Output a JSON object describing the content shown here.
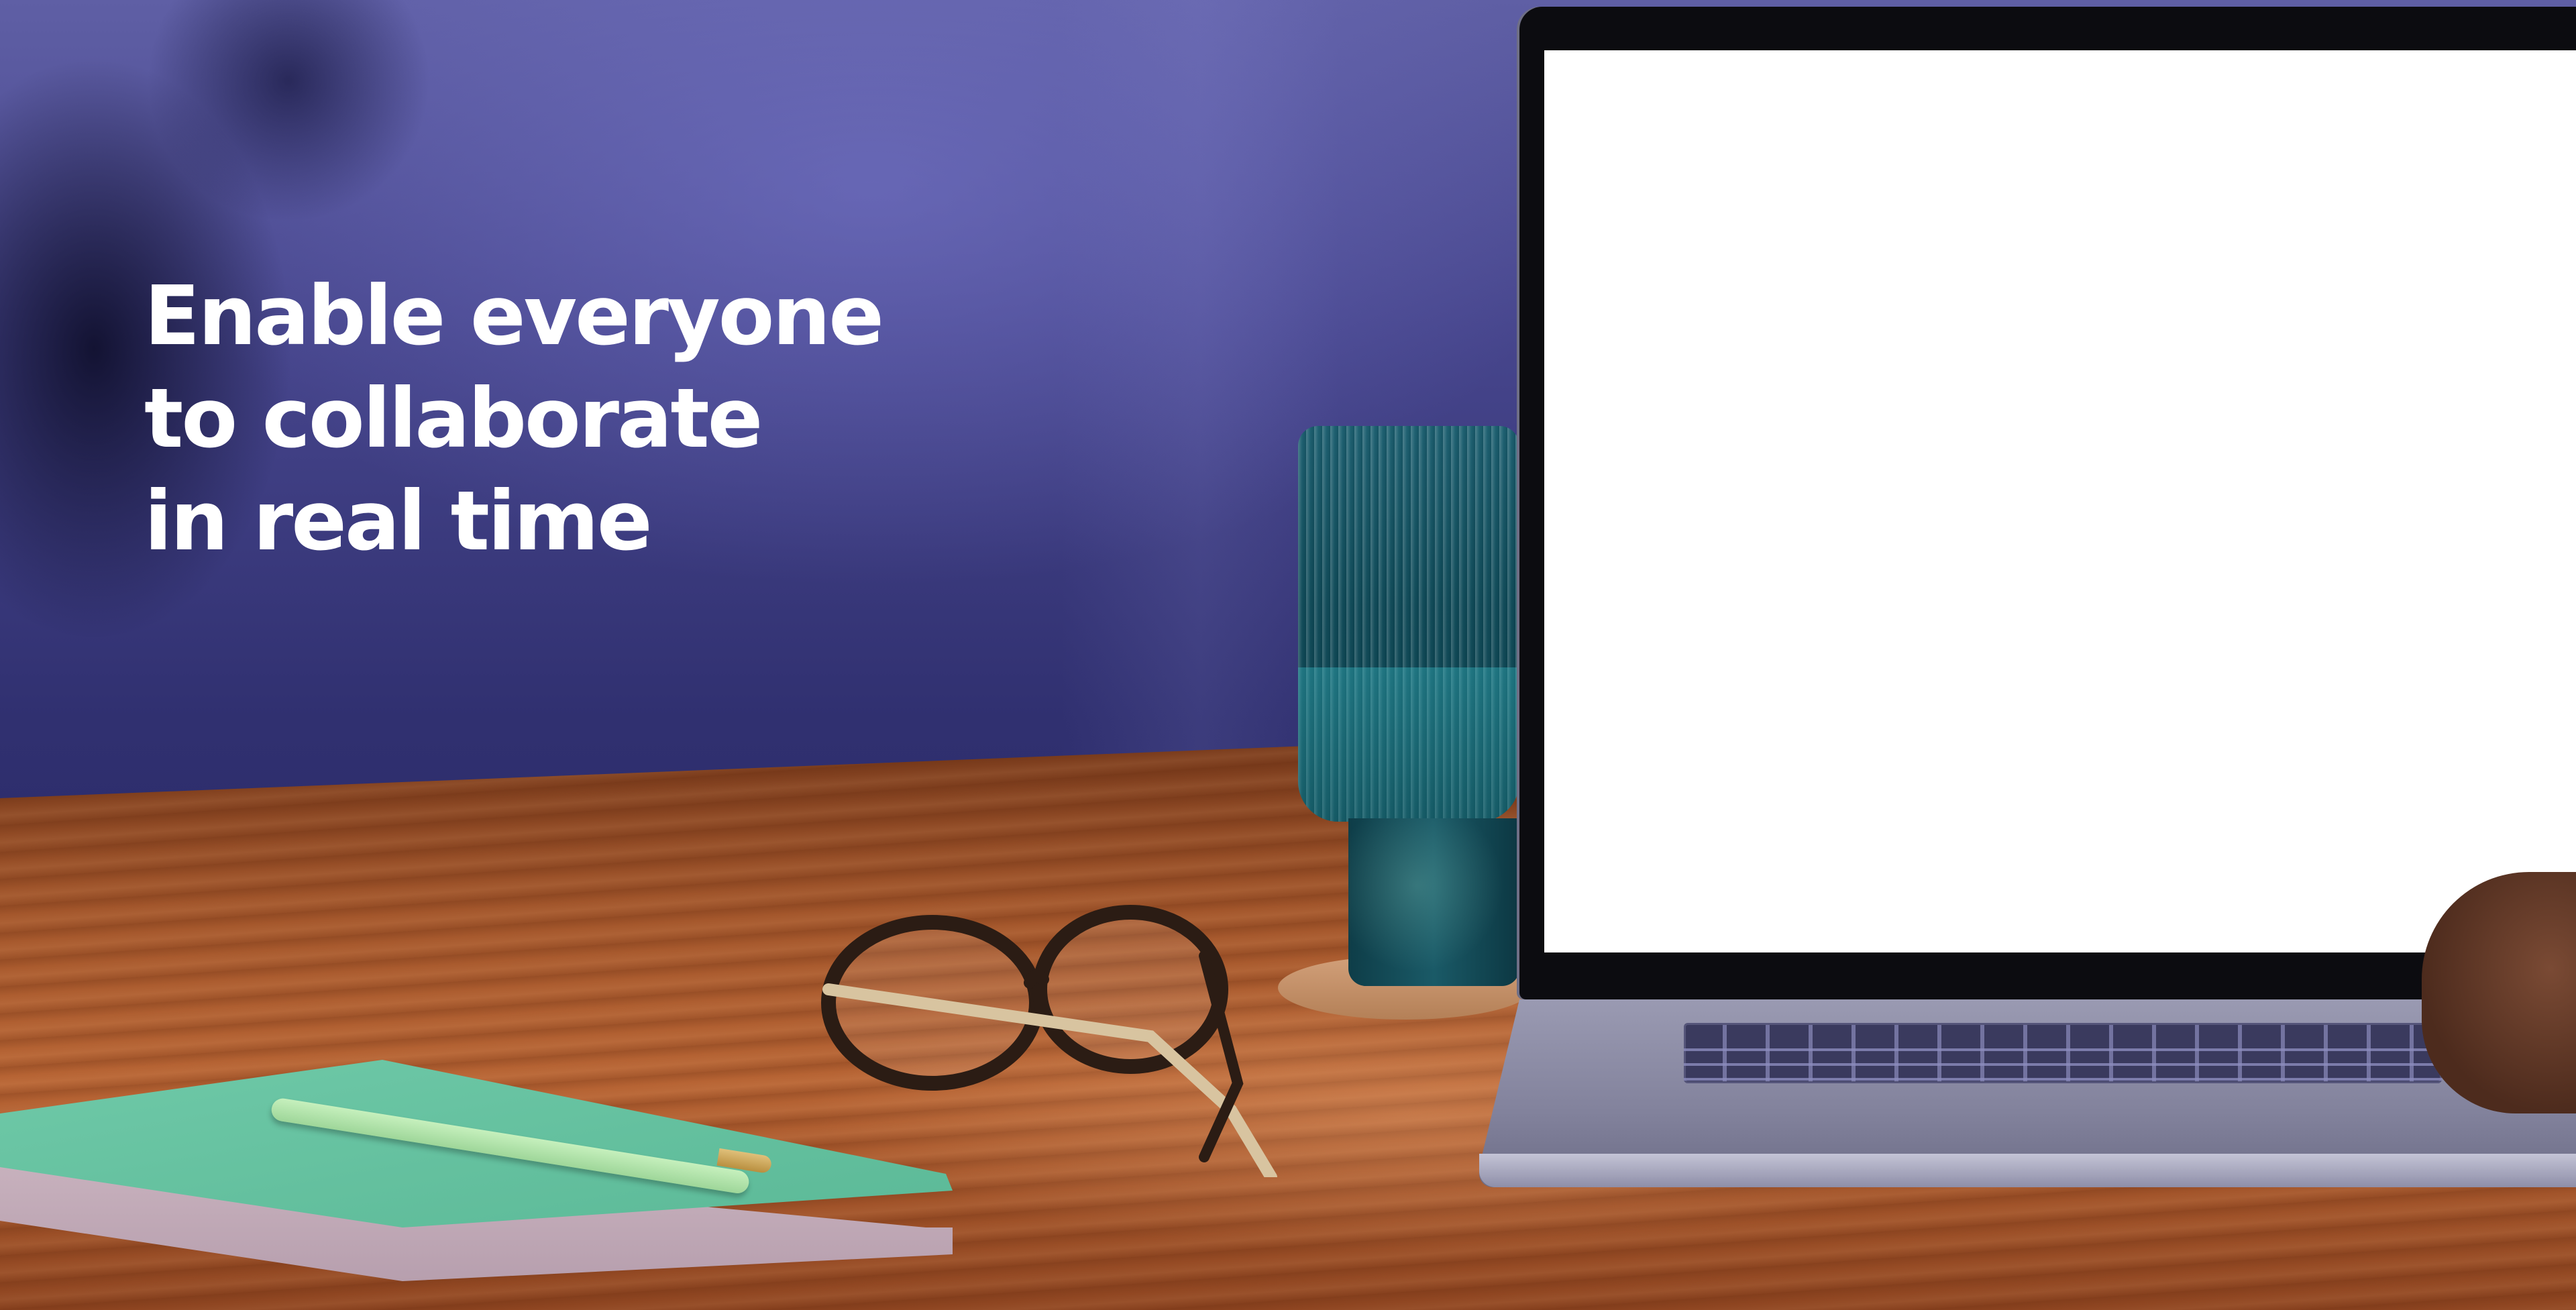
{
  "headline": {
    "line1": "Enable everyone",
    "line2": "to collaborate",
    "line3": "in real time"
  },
  "colors": {
    "headline_text": "#ffffff",
    "wall": "#47468d",
    "desk": "#a4572c",
    "notebook": "#6fc9a8"
  }
}
